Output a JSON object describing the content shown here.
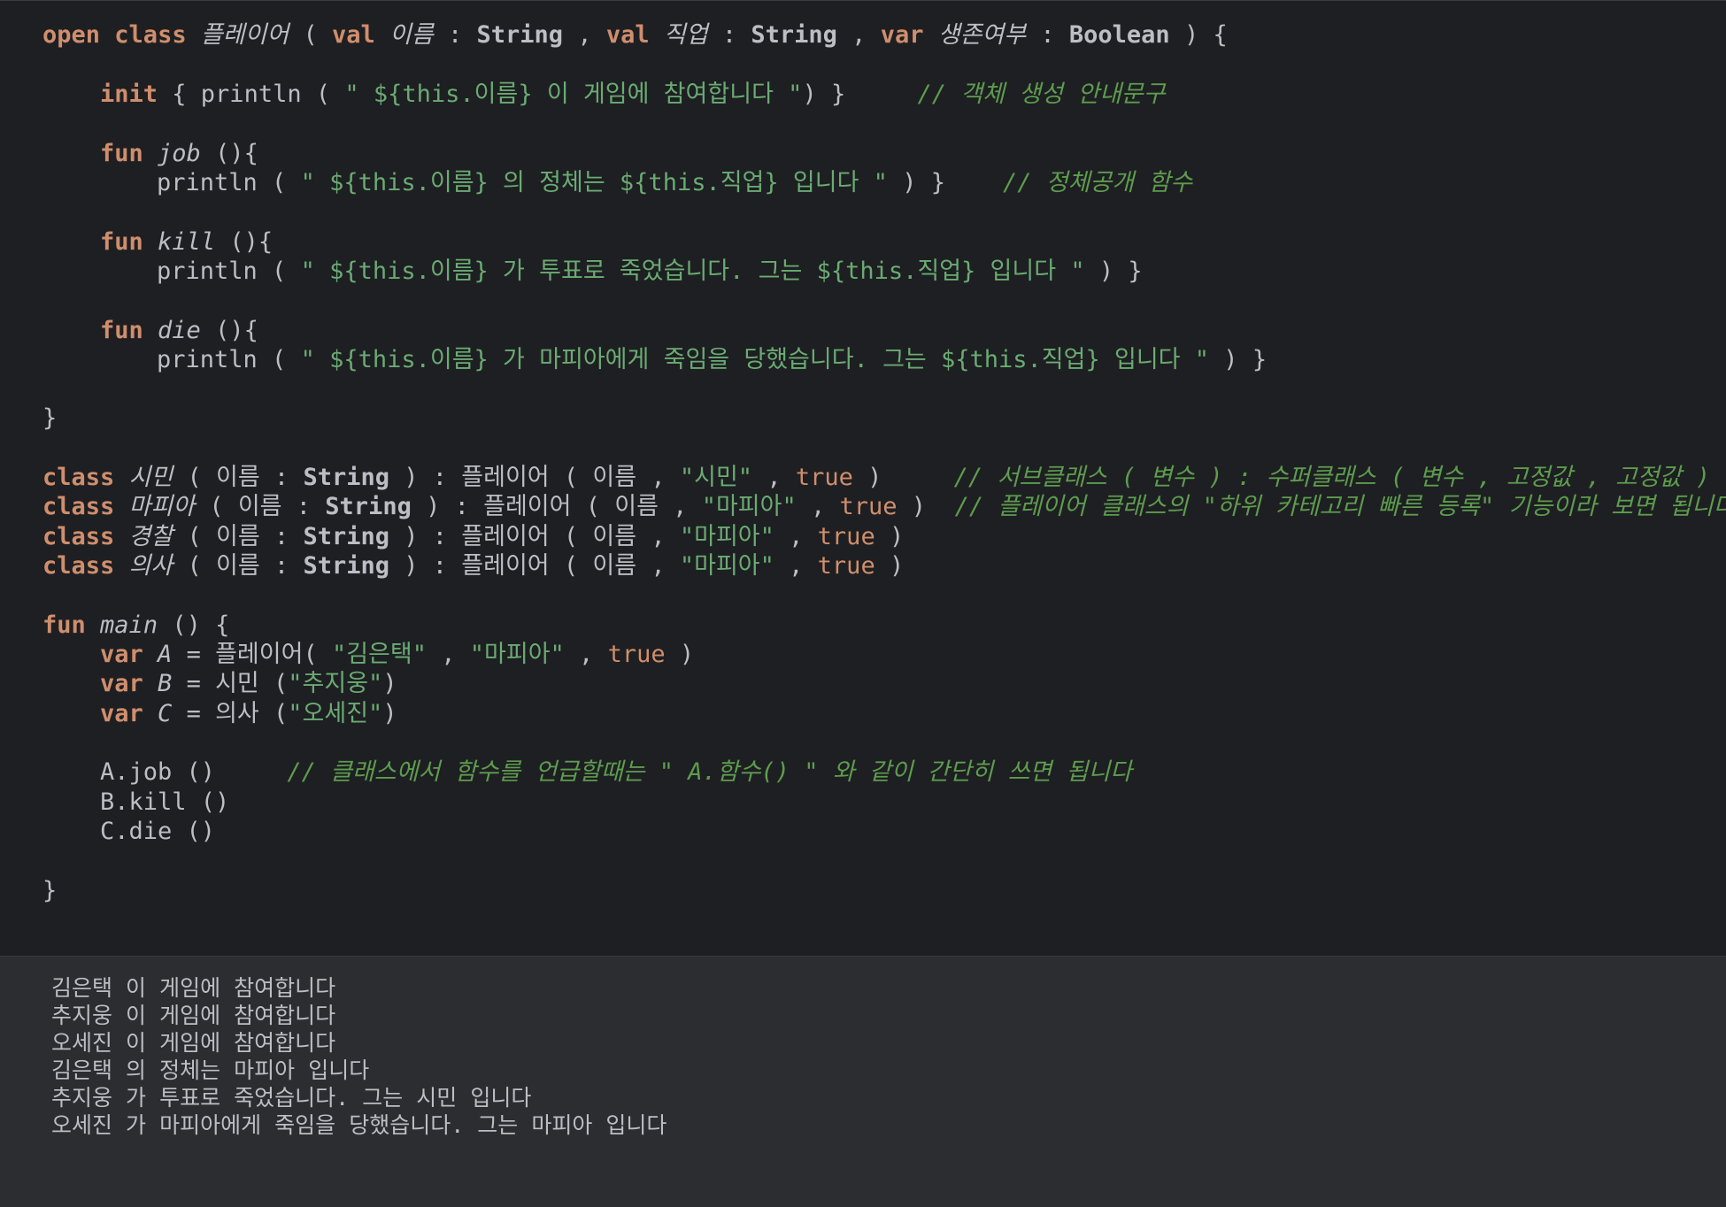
{
  "code": {
    "l01": {
      "open": "open",
      "class": "class",
      "name": "플레이어",
      "p1": " ( ",
      "val1": "val",
      "arg1": "이름",
      "c1": " : ",
      "t1": "String",
      "comma1": " , ",
      "val2": "val",
      "arg2": "직업",
      "c2": " : ",
      "t2": "String",
      "comma2": " , ",
      "var3": "var",
      "arg3": "생존여부",
      "c3": " : ",
      "t3": "Boolean",
      "end": " ) {"
    },
    "l02": {
      "init": "init",
      "a": " { println ( ",
      "s": "\" ${this.이름} 이 게임에 참여합니다 \"",
      "b": ") }     ",
      "cm": "// 객체 생성 안내문구"
    },
    "l03": {
      "fun": "fun",
      "name": "job",
      "rest": " (){"
    },
    "l04": {
      "a": "println ( ",
      "s": "\" ${this.이름} 의 정체는 ${this.직업} 입니다 \"",
      "b": " ) }    ",
      "cm": "// 정체공개 함수"
    },
    "l05": {
      "fun": "fun",
      "name": "kill",
      "rest": " (){"
    },
    "l06": {
      "a": "println ( ",
      "s": "\" ${this.이름} 가 투표로 죽었습니다. 그는 ${this.직업} 입니다 \"",
      "b": " ) }"
    },
    "l07": {
      "fun": "fun",
      "name": "die",
      "rest": " (){"
    },
    "l08": {
      "a": "println ( ",
      "s": "\" ${this.이름} 가 마피아에게 죽임을 당했습니다. 그는 ${this.직업} 입니다 \"",
      "b": " ) }"
    },
    "l09": "}",
    "l10": {
      "class": "class",
      "name": "시민",
      "a": " ( 이름 : ",
      "t": "String",
      "b": " ) : 플레이어 ( 이름 , ",
      "s": "\"시민\"",
      "c": " , ",
      "tr": "true",
      "d": " )     ",
      "cm": "// 서브클래스 ( 변수 ) : 수퍼클래스 ( 변수 , 고정값 , 고정값 )"
    },
    "l11": {
      "class": "class",
      "name": "마피아",
      "a": " ( 이름 : ",
      "t": "String",
      "b": " ) : 플레이어 ( 이름 , ",
      "s": "\"마피아\"",
      "c": " , ",
      "tr": "true",
      "d": " )  ",
      "cm": "// 플레이어 클래스의 \"하위 카테고리 빠른 등록\" 기능이라 보면 됩니다"
    },
    "l12": {
      "class": "class",
      "name": "경찰",
      "a": " ( 이름 : ",
      "t": "String",
      "b": " ) : 플레이어 ( 이름 , ",
      "s": "\"마피아\"",
      "c": " , ",
      "tr": "true",
      "d": " )"
    },
    "l13": {
      "class": "class",
      "name": "의사",
      "a": " ( 이름 : ",
      "t": "String",
      "b": " ) : 플레이어 ( 이름 , ",
      "s": "\"마피아\"",
      "c": " , ",
      "tr": "true",
      "d": " )"
    },
    "l14": {
      "fun": "fun",
      "name": "main",
      "rest": " () {"
    },
    "l15": {
      "var": "var",
      "name": "A",
      "a": " = 플레이어( ",
      "s1": "\"김은택\"",
      "c1": " , ",
      "s2": "\"마피아\"",
      "c2": " , ",
      "tr": "true",
      "d": " )"
    },
    "l16": {
      "var": "var",
      "name": "B",
      "a": " = 시민 (",
      "s": "\"추지웅\"",
      "d": ")"
    },
    "l17": {
      "var": "var",
      "name": "C",
      "a": " = 의사 (",
      "s": "\"오세진\"",
      "d": ")"
    },
    "l18": {
      "a": "A.job ()     ",
      "cm": "// 클래스에서 함수를 언급할때는 \" A.함수() \" 와 같이 간단히 쓰면 됩니다"
    },
    "l19": "B.kill ()",
    "l20": "C.die ()",
    "l21": "}"
  },
  "output": [
    "김은택 이 게임에 참여합니다",
    "추지웅 이 게임에 참여합니다",
    "오세진 이 게임에 참여합니다",
    "김은택 의 정체는 마피아 입니다",
    "추지웅 가 투표로 죽었습니다. 그는 시민 입니다",
    "오세진 가 마피아에게 죽임을 당했습니다. 그는 마피아 입니다"
  ]
}
